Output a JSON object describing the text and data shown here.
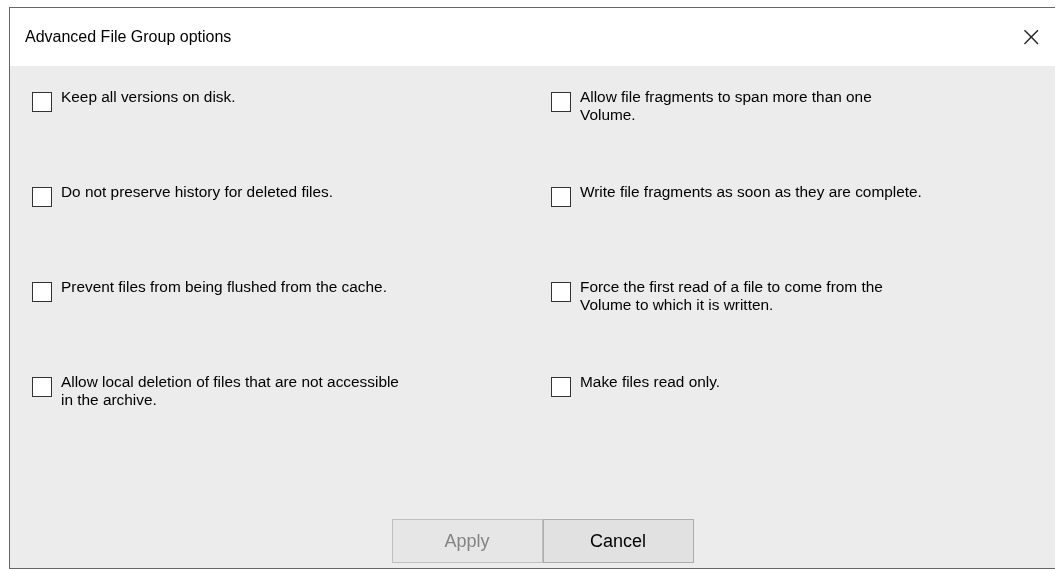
{
  "window": {
    "title": "Advanced File Group options",
    "close": "×"
  },
  "options": [
    {
      "label": "Keep all versions on disk.",
      "checked": false
    },
    {
      "label": "Allow file fragments to span more than one\nVolume.",
      "checked": false
    },
    {
      "label": "Do not preserve history for deleted files.",
      "checked": false
    },
    {
      "label": "Write file fragments as soon as they are complete.",
      "checked": false
    },
    {
      "label": "Prevent files from being flushed from the cache.",
      "checked": false
    },
    {
      "label": "Force the first read of a file to come from the\nVolume to which it is written.",
      "checked": false
    },
    {
      "label": "Allow local deletion of files that are not accessible\nin the archive.",
      "checked": false
    },
    {
      "label": "Make files read only.",
      "checked": false
    }
  ],
  "buttons": [
    {
      "label": "Apply",
      "disabled": true
    },
    {
      "label": "Cancel",
      "disabled": false
    }
  ]
}
